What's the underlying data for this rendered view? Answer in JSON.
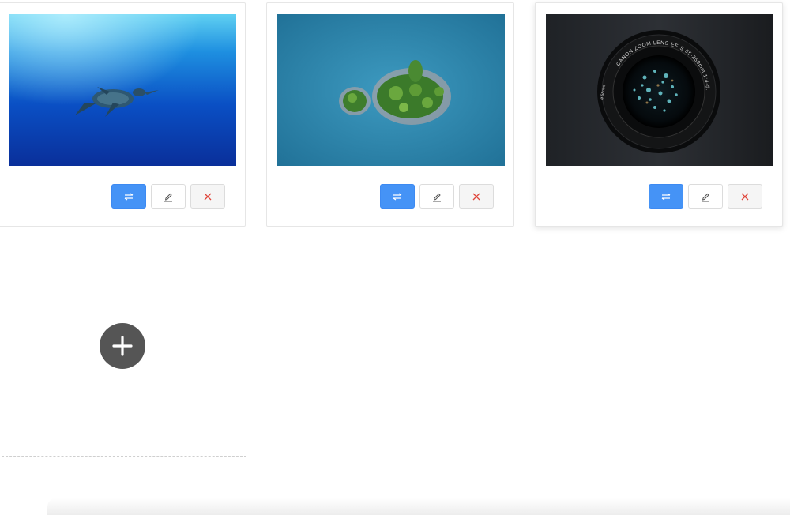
{
  "gallery": {
    "cards": [
      {
        "image_subject": "sea turtle swimming underwater",
        "icons": {
          "swap": "swap-arrows-icon",
          "edit": "pencil-icon",
          "delete": "close-icon"
        }
      },
      {
        "image_subject": "aerial view of forested island",
        "icons": {
          "swap": "swap-arrows-icon",
          "edit": "pencil-icon",
          "delete": "close-icon"
        }
      },
      {
        "image_subject": "camera lens close-up",
        "lens_text": "CANON ZOOM LENS EF-S 55-250mm 1:4-5.6 IS II",
        "lens_text_2": "ø 58mm",
        "icons": {
          "swap": "swap-arrows-icon",
          "edit": "pencil-icon",
          "delete": "close-icon"
        }
      }
    ],
    "add_card": {
      "icon": "plus-icon"
    }
  },
  "colors": {
    "primary": "#4593f6",
    "danger": "#e0453a",
    "add_button": "#555555"
  }
}
